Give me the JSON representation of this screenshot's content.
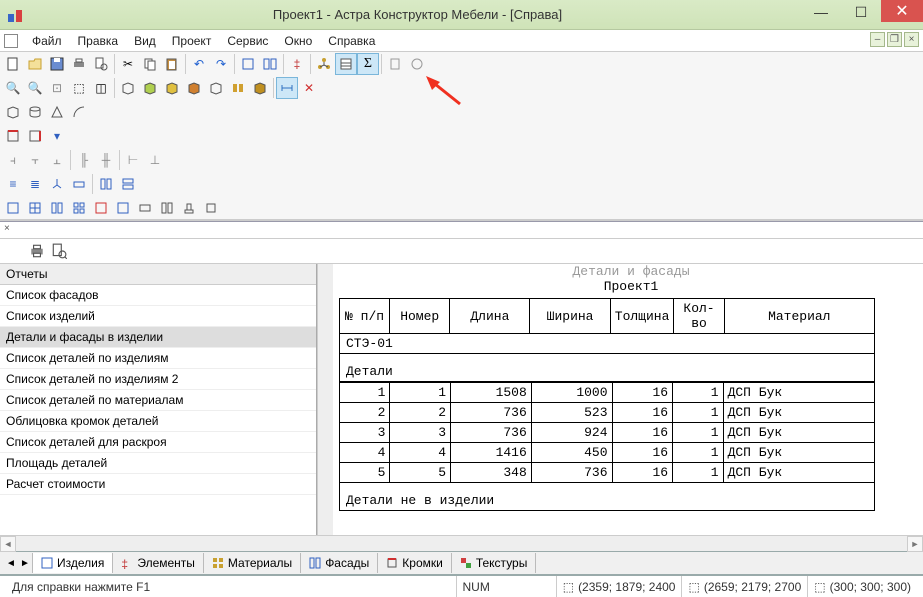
{
  "title": "Проект1 - Астра Конструктор Мебели - [Справа]",
  "menu": {
    "items": [
      "Файл",
      "Правка",
      "Вид",
      "Проект",
      "Сервис",
      "Окно",
      "Справка"
    ]
  },
  "reports_header": "Отчеты",
  "reports": [
    "Список фасадов",
    "Список изделий",
    "Детали и фасады в изделии",
    "Список деталей по изделиям",
    "Список деталей по изделиям 2",
    "Список деталей по материалам",
    "Облицовка кромок деталей",
    "Список деталей для раскроя",
    "Площадь деталей",
    "Расчет стоимости"
  ],
  "reports_selected": 2,
  "report": {
    "heading": "Детали и фасады",
    "project": "Проект1",
    "columns": [
      "№ п/п",
      "Номер",
      "Длина",
      "Ширина",
      "Толщина",
      "Кол-во",
      "Материал"
    ],
    "group_code": "СТЭ-01",
    "section1": "Детали",
    "section2": "Детали не в изделии",
    "rows": [
      {
        "n": "1",
        "num": "1",
        "len": "1508",
        "w": "1000",
        "t": "16",
        "q": "1",
        "mat": "ДСП Бук"
      },
      {
        "n": "2",
        "num": "2",
        "len": "736",
        "w": "523",
        "t": "16",
        "q": "1",
        "mat": "ДСП Бук"
      },
      {
        "n": "3",
        "num": "3",
        "len": "736",
        "w": "924",
        "t": "16",
        "q": "1",
        "mat": "ДСП Бук"
      },
      {
        "n": "4",
        "num": "4",
        "len": "1416",
        "w": "450",
        "t": "16",
        "q": "1",
        "mat": "ДСП Бук"
      },
      {
        "n": "5",
        "num": "5",
        "len": "348",
        "w": "736",
        "t": "16",
        "q": "1",
        "mat": "ДСП Бук"
      }
    ]
  },
  "tabs": [
    "Изделия",
    "Элементы",
    "Материалы",
    "Фасады",
    "Кромки",
    "Текстуры"
  ],
  "status": {
    "help": "Для справки нажмите F1",
    "num": "NUM",
    "c1": "(2359; 1879; 2400",
    "c2": "(2659; 2179; 2700",
    "c3": "(300; 300; 300)"
  }
}
